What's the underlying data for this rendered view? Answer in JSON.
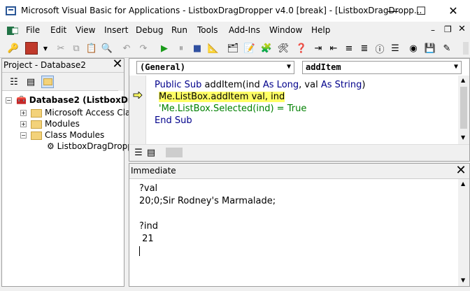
{
  "window": {
    "title": "Microsoft Visual Basic for Applications - ListboxDragDropper v4.0 [break] - [ListboxDragDropp...",
    "minimize": "—",
    "maximize": "☐",
    "close": "✕"
  },
  "menu": [
    "File",
    "Edit",
    "View",
    "Insert",
    "Debug",
    "Run",
    "Tools",
    "Add-Ins",
    "Window",
    "Help"
  ],
  "project": {
    "title": "Project - Database2",
    "items": [
      {
        "label": "Database2 (ListboxDr"
      },
      {
        "label": "Microsoft Access Clas"
      },
      {
        "label": "Modules"
      },
      {
        "label": "Class Modules"
      },
      {
        "label": "ListboxDragDropp"
      }
    ]
  },
  "code": {
    "object_combo": "(General)",
    "proc_combo": "addItem",
    "lines": [
      {
        "kw": "Public Sub",
        "rest": " addItem(ind ",
        "kw2": "As Long",
        ",": ", val ",
        "kw3": "As String",
        ")": ")"
      },
      {
        "text": "Me.ListBox.addItem val, ind"
      },
      {
        "text": "'Me.ListBox.Selected(ind) = True"
      },
      {
        "text": "End Sub"
      }
    ],
    "line1_plain": "Public Sub addItem(ind As Long, val As String)"
  },
  "immediate": {
    "title": "Immediate",
    "lines": [
      "?val",
      "20;0;Sir Rodney's Marmalade;",
      "",
      "?ind",
      " 21"
    ]
  }
}
